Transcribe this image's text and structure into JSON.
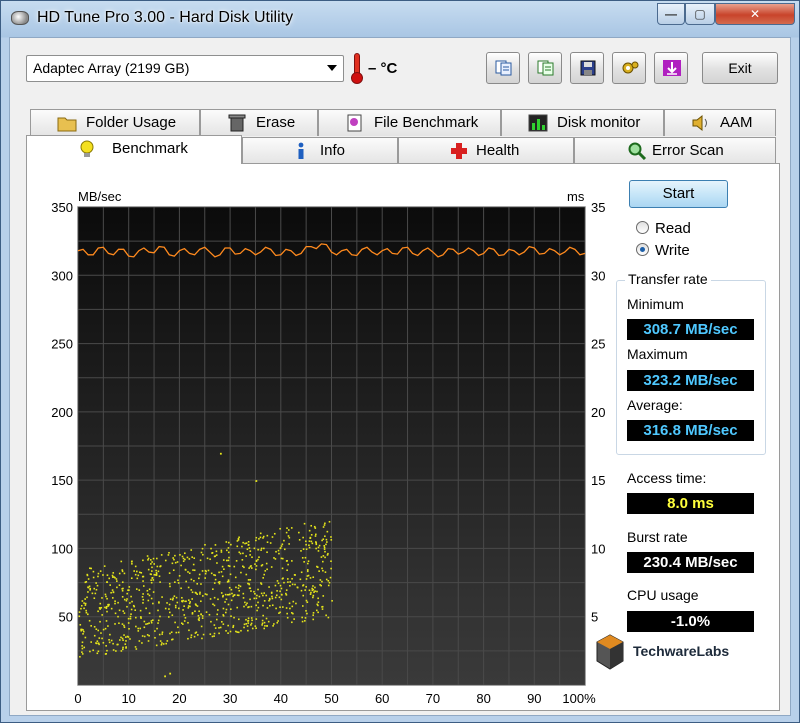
{
  "window": {
    "title": "HD Tune Pro 3.00 - Hard Disk Utility",
    "controls": {
      "minimize": "—",
      "maximize": "▢",
      "close": "✕"
    }
  },
  "toolbar": {
    "drive": "Adaptec Array (2199 GB)",
    "temperature": "– °C",
    "buttons": [
      "copy-info-icon",
      "copy-text-icon",
      "save-icon",
      "options-icon",
      "download-icon"
    ],
    "exit_label": "Exit"
  },
  "tabs": {
    "row1": [
      {
        "label": "Folder Usage",
        "icon": "folder-icon"
      },
      {
        "label": "Erase",
        "icon": "trash-icon"
      },
      {
        "label": "File Benchmark",
        "icon": "file-benchmark-icon"
      },
      {
        "label": "Disk monitor",
        "icon": "disk-monitor-icon"
      },
      {
        "label": "AAM",
        "icon": "speaker-icon"
      }
    ],
    "row2": [
      {
        "label": "Benchmark",
        "icon": "lightbulb-icon",
        "active": true
      },
      {
        "label": "Info",
        "icon": "info-icon"
      },
      {
        "label": "Health",
        "icon": "health-cross-icon"
      },
      {
        "label": "Error Scan",
        "icon": "magnifier-icon"
      }
    ]
  },
  "benchmark": {
    "start_label": "Start",
    "mode_options": [
      "Read",
      "Write"
    ],
    "mode_selected": "Write",
    "transfer_rate_title": "Transfer rate",
    "minimum_label": "Minimum",
    "minimum_value": "308.7 MB/sec",
    "maximum_label": "Maximum",
    "maximum_value": "323.2 MB/sec",
    "average_label": "Average:",
    "average_value": "316.8 MB/sec",
    "access_time_label": "Access time:",
    "access_time_value": "8.0 ms",
    "burst_rate_label": "Burst rate",
    "burst_rate_value": "230.4 MB/sec",
    "cpu_usage_label": "CPU usage",
    "cpu_usage_value": "-1.0%"
  },
  "watermark": {
    "text": "TechwareLabs"
  },
  "colors": {
    "plot_bg": "#0b0b0b",
    "grid": "#4a4a4a",
    "transfer_line": "#ff8a1e",
    "access_points": "#e6e61a",
    "value_blue": "#4fc8ff",
    "value_yellow": "#ffff3c"
  },
  "chart_data": {
    "type": "line",
    "left_axis_label": "MB/sec",
    "right_axis_label": "ms",
    "x_ticks": [
      "0",
      "10",
      "20",
      "30",
      "40",
      "50",
      "60",
      "70",
      "80",
      "90",
      "100%"
    ],
    "y_left_ticks": [
      "350",
      "300",
      "250",
      "200",
      "150",
      "100",
      "50"
    ],
    "y_right_ticks": [
      "35",
      "30",
      "25",
      "20",
      "15",
      "10",
      "5"
    ],
    "x_range": [
      0,
      100
    ],
    "y_left_range": [
      0,
      350
    ],
    "y_right_range": [
      0,
      35
    ],
    "grid": true,
    "transfer_rate": {
      "unit": "MB/sec",
      "x": [
        0,
        2,
        4,
        6,
        8,
        10,
        12,
        14,
        16,
        18,
        20,
        22,
        24,
        26,
        28,
        30,
        32,
        34,
        36,
        38,
        40,
        42,
        44,
        46,
        48,
        50,
        52,
        54,
        56,
        58,
        60,
        62,
        64,
        66,
        68,
        70,
        72,
        74,
        76,
        78,
        80,
        82,
        84,
        86,
        88,
        90,
        92,
        94,
        96,
        98,
        100
      ],
      "y": [
        318,
        315,
        320,
        316,
        319,
        314,
        318,
        317,
        321,
        315,
        318,
        316,
        319,
        317,
        315,
        320,
        316,
        318,
        317,
        319,
        315,
        318,
        316,
        321,
        323,
        317,
        318,
        315,
        319,
        317,
        318,
        316,
        320,
        316,
        318,
        317,
        315,
        319,
        317,
        318,
        316,
        319,
        315,
        318,
        317,
        320,
        316,
        318,
        317,
        319,
        316
      ]
    },
    "access_time_scatter": {
      "unit": "ms",
      "x_range": [
        0,
        50
      ],
      "y_range_ms": [
        2.0,
        12.5
      ],
      "outliers": [
        [
          28,
          17.0
        ],
        [
          35,
          15.0
        ],
        [
          18,
          0.9
        ],
        [
          17,
          0.7
        ]
      ]
    }
  }
}
